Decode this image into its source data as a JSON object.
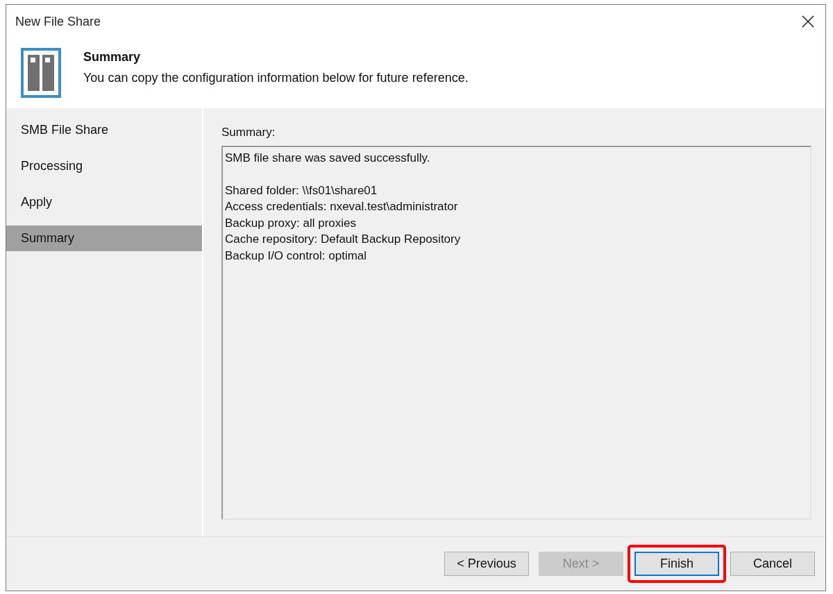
{
  "window": {
    "title": "New File Share"
  },
  "header": {
    "title": "Summary",
    "subtitle": "You can copy the configuration information below for future reference."
  },
  "steps": [
    {
      "label": "SMB File Share",
      "selected": false
    },
    {
      "label": "Processing",
      "selected": false
    },
    {
      "label": "Apply",
      "selected": false
    },
    {
      "label": "Summary",
      "selected": true
    }
  ],
  "summary": {
    "label": "Summary:",
    "status_line": "SMB file share was saved successfully.",
    "details": [
      "Shared folder: \\\\fs01\\share01",
      "Access credentials: nxeval.test\\administrator",
      "Backup proxy: all proxies",
      "Cache repository: Default Backup Repository",
      "Backup I/O control: optimal"
    ]
  },
  "buttons": [
    {
      "label": "< Previous",
      "disabled": false,
      "default": false,
      "highlighted": false
    },
    {
      "label": "Next >",
      "disabled": true,
      "default": false,
      "highlighted": false
    },
    {
      "label": "Finish",
      "disabled": false,
      "default": true,
      "highlighted": true
    },
    {
      "label": "Cancel",
      "disabled": false,
      "default": false,
      "highlighted": false
    }
  ]
}
